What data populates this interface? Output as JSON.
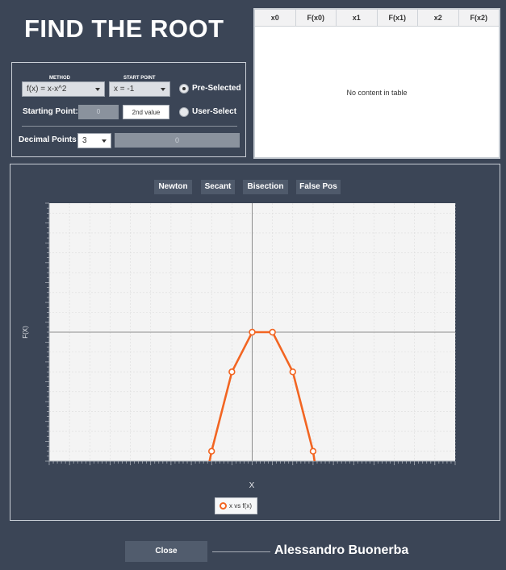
{
  "title": "FIND THE ROOT",
  "controls": {
    "method_label": "METHOD",
    "start_point_label": "START POINT",
    "method_value": "f(x) = x-x^2",
    "start_point_value": "x = -1",
    "radio_preselected": "Pre-Selected",
    "radio_userselect": "User-Select",
    "starting_point_label": "Starting Point:",
    "starting_point_value": "0",
    "second_value_button": "2nd value",
    "decimal_points_label": "Decimal Points",
    "decimal_points_value": "3",
    "decimal_result": "0"
  },
  "table": {
    "columns": [
      "x0",
      "F(x0)",
      "x1",
      "F(x1)",
      "x2",
      "F(x2)"
    ],
    "empty_text": "No content in table"
  },
  "methods": [
    "Newton",
    "Secant",
    "Bisection",
    "False Pos"
  ],
  "chart_data": {
    "type": "line",
    "xlabel": "X",
    "ylabel": "F(X)",
    "xlim": [
      -10,
      10
    ],
    "ylim": [
      -6.5,
      6.5
    ],
    "grid": true,
    "series": [
      {
        "name": "x vs f(x)",
        "color": "#f26522",
        "x": [
          -2,
          -1,
          0,
          1,
          2,
          3
        ],
        "y": [
          -6,
          -2,
          0,
          0,
          -2,
          -6
        ],
        "line_extends": [
          [
            -2.8,
            -10
          ],
          [
            3.6,
            -10
          ]
        ]
      }
    ],
    "legend": "bottom"
  },
  "footer": {
    "close_button": "Close",
    "author": "Alessandro Buonerba"
  }
}
